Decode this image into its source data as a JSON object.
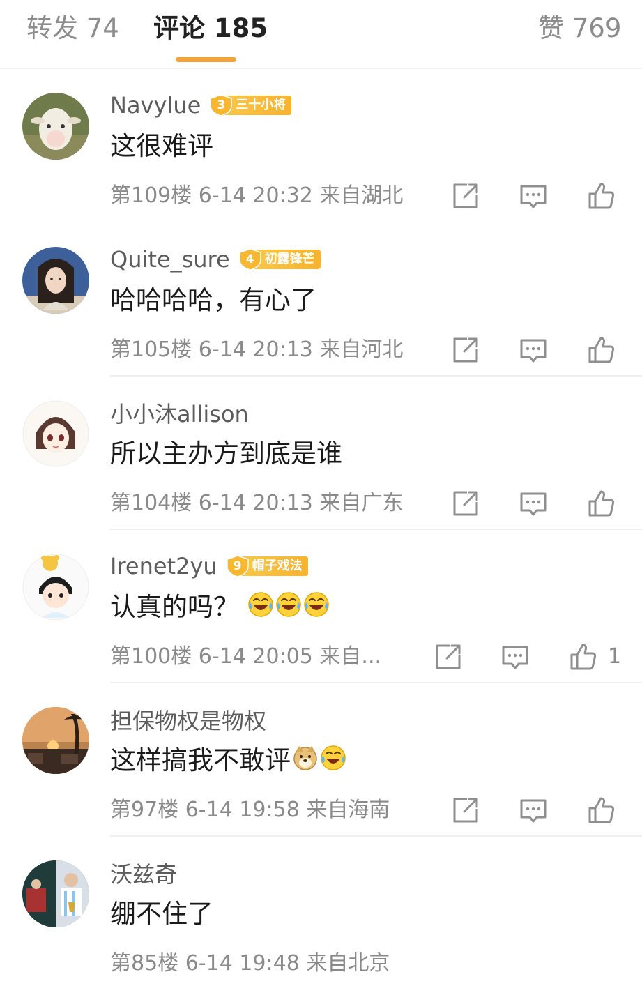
{
  "tabs": [
    {
      "label": "转发 74"
    },
    {
      "label": "评论 185"
    },
    {
      "label": "赞 769"
    }
  ],
  "colors": {
    "accent": "#f0a43a",
    "badge": "#f6b32f",
    "meta": "#8a8a8a"
  },
  "comments": [
    {
      "username": "Navylue",
      "badge_level": "3",
      "badge_label": "三十小将",
      "text": "这很难评",
      "meta": "第109楼 6-14 20:32 来自湖北",
      "like_count": ""
    },
    {
      "username": "Quite_sure",
      "badge_level": "4",
      "badge_label": "初露锋芒",
      "text": "哈哈哈哈，有心了",
      "meta": "第105楼 6-14 20:13 来自河北",
      "like_count": ""
    },
    {
      "username": "小小沐allison",
      "badge_level": "",
      "badge_label": "",
      "text": "所以主办方到底是谁",
      "meta": "第104楼 6-14 20:13 来自广东",
      "like_count": ""
    },
    {
      "username": "Irenet2yu",
      "badge_level": "9",
      "badge_label": "帽子戏法",
      "text": "认真的吗？",
      "emojis": [
        "laugh-cry",
        "laugh-cry",
        "laugh-cry"
      ],
      "meta": "第100楼 6-14 20:05 来自...",
      "like_count": "1"
    },
    {
      "username": "担保物权是物权",
      "badge_level": "",
      "badge_label": "",
      "text": "这样搞我不敢评",
      "emojis": [
        "doge",
        "laugh-cry"
      ],
      "meta": "第97楼 6-14 19:58 来自海南",
      "like_count": ""
    },
    {
      "username": "沃兹奇",
      "badge_level": "",
      "badge_label": "",
      "text": "绷不住了",
      "meta": "第85楼 6-14 19:48 来自北京",
      "like_count": ""
    }
  ]
}
